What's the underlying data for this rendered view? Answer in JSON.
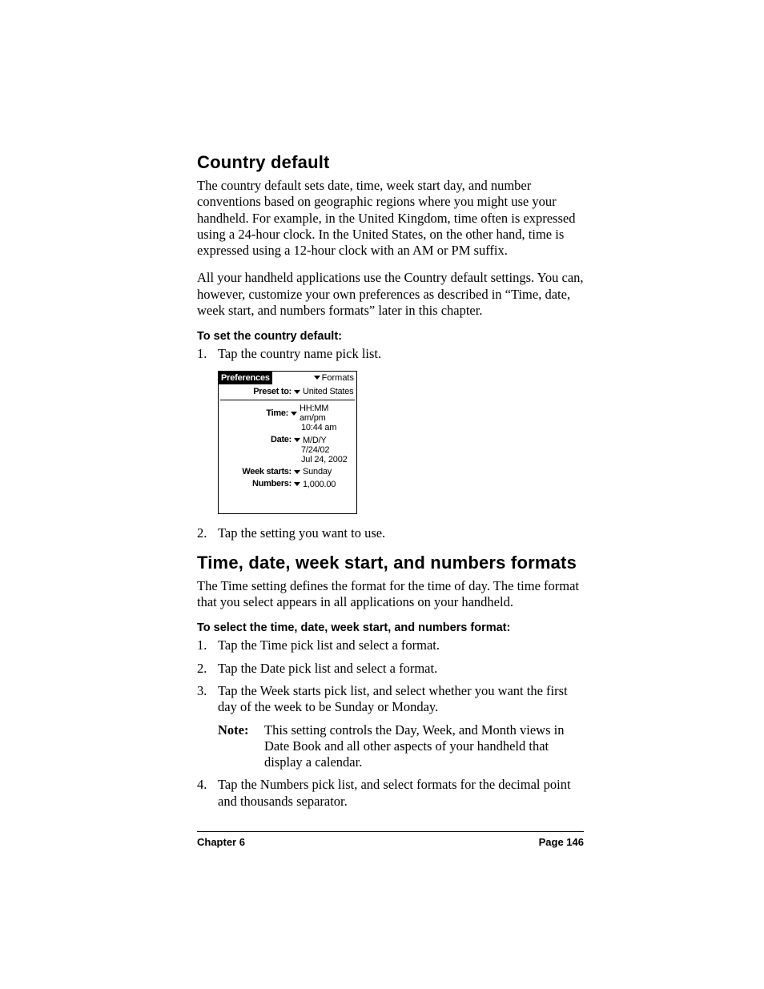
{
  "sections": {
    "country": {
      "heading": "Country default",
      "p1": "The country default sets date, time, week start day, and number conventions based on geographic regions where you might use your handheld. For example, in the United Kingdom, time often is expressed using a 24-hour clock. In the United States, on the other hand, time is expressed using a 12-hour clock with an AM or PM suffix.",
      "p2": "All your handheld applications use the Country default settings. You can, however, customize your own preferences as described in “Time, date, week start, and numbers formats” later in this chapter.",
      "proc_head": "To set the country default:",
      "step1": "Tap the country name pick list.",
      "step2": "Tap the setting you want to use."
    },
    "formats": {
      "heading": "Time, date, week start, and numbers formats",
      "p1": "The Time setting defines the format for the time of day. The time format that you select appears in all applications on your handheld.",
      "proc_head": "To select the time, date, week start, and numbers format:",
      "step1": "Tap the Time pick list and select a format.",
      "step2": "Tap the Date pick list and select a format.",
      "step3": "Tap the Week starts pick list, and select whether you want the first day of the week to be Sunday or Monday.",
      "note_label": "Note:",
      "note_text": "This setting controls the Day, Week, and Month views in Date Book and all other aspects of your handheld that display a calendar.",
      "step4": "Tap the Numbers pick list, and select formats for the decimal point and thousands separator."
    }
  },
  "screenshot": {
    "title": "Preferences",
    "menu": "Formats",
    "preset_label": "Preset to:",
    "preset_value": "United States",
    "time_label": "Time:",
    "time_value": "HH:MM am/pm",
    "time_example": "10:44 am",
    "date_label": "Date:",
    "date_value": "M/D/Y",
    "date_example1": "7/24/02",
    "date_example2": "Jul 24, 2002",
    "week_label": "Week starts:",
    "week_value": "Sunday",
    "numbers_label": "Numbers:",
    "numbers_value": "1,000.00"
  },
  "footer": {
    "chapter": "Chapter 6",
    "page": "Page 146"
  }
}
